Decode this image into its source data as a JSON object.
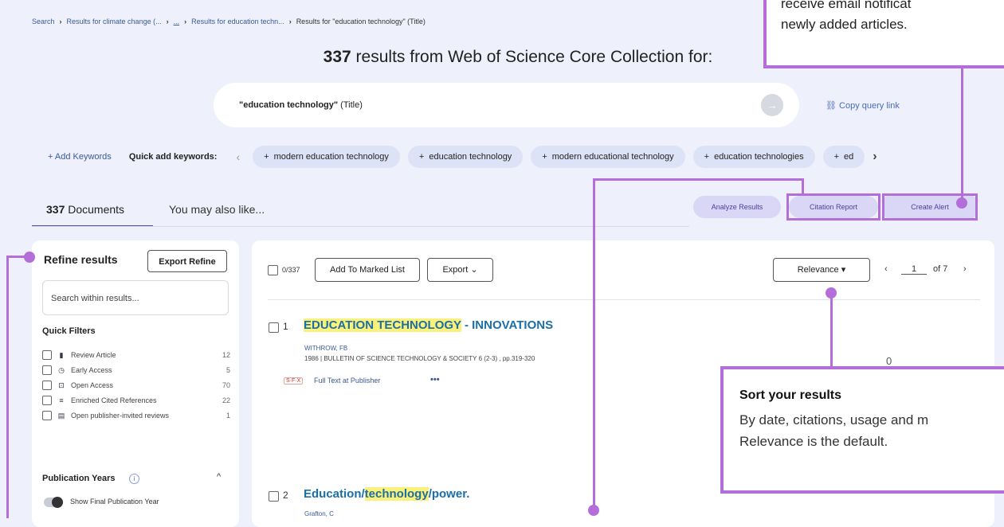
{
  "breadcrumb": {
    "items": [
      "Search",
      "Results for climate change (...",
      "...",
      "Results for education techn...",
      "Results for \"education technology\" (Title)"
    ]
  },
  "header": {
    "count": "337",
    "title_rest": "results from Web of Science Core Collection for:"
  },
  "search": {
    "query_bold": "\"education technology\"",
    "query_rest": " (Title)",
    "copy_link": "Copy query link"
  },
  "keywords": {
    "add_label": "+ Add Keywords",
    "quick_label": "Quick add keywords:",
    "chips": [
      "modern education technology",
      "education technology",
      "modern educational technology",
      "education technologies",
      "ed"
    ]
  },
  "tabs": {
    "docs_count": "337",
    "docs_label": "Documents",
    "also_like": "You may also like..."
  },
  "actions": {
    "analyze": "Analyze Results",
    "citation": "Citation Report",
    "alert": "Create Alert"
  },
  "refine": {
    "title": "Refine results",
    "export": "Export Refine",
    "search_placeholder": "Search within results...",
    "quick_filters_title": "Quick Filters",
    "filters": [
      {
        "label": "Review Article",
        "count": "12",
        "icon": "document-icon"
      },
      {
        "label": "Early Access",
        "count": "5",
        "icon": "clock-icon"
      },
      {
        "label": "Open Access",
        "count": "70",
        "icon": "lock-open-icon"
      },
      {
        "label": "Enriched Cited References",
        "count": "22",
        "icon": "list-icon"
      },
      {
        "label": "Open publisher-invited reviews",
        "count": "1",
        "icon": "review-icon"
      }
    ],
    "pub_years_title": "Publication Years",
    "show_final": "Show Final Publication Year"
  },
  "toolbar": {
    "selected": "0/337",
    "add_marked": "Add To Marked List",
    "export": "Export",
    "sort": "Relevance",
    "page": "1",
    "of_pages": "of 7"
  },
  "results": [
    {
      "num": "1",
      "title_hl": "EDUCATION TECHNOLOGY",
      "title_rest": " - INNOVATIONS",
      "author": "WITHROW, FB",
      "source": "1986 | BULLETIN OF SCIENCE TECHNOLOGY & SOCIETY 6 (2-3) , pp.319-320",
      "sfx": "S·F·X",
      "fulltext": "Full Text at Publisher",
      "more": "•••",
      "cites": "0"
    },
    {
      "num": "2",
      "title_pre": "Education/",
      "title_hl": "technology",
      "title_rest": "/power.",
      "author": "Grafton, C"
    }
  ],
  "annotations": {
    "alert_line1": "receive email notificat",
    "alert_line2": "newly added articles.",
    "sort_title": "Sort your results",
    "sort_line1": "By date, citations, usage and m",
    "sort_line2": "Relevance is the default."
  },
  "colors": {
    "accent": "#b46ed9",
    "highlight": "#fbf07a",
    "link": "#1a6fa8"
  }
}
